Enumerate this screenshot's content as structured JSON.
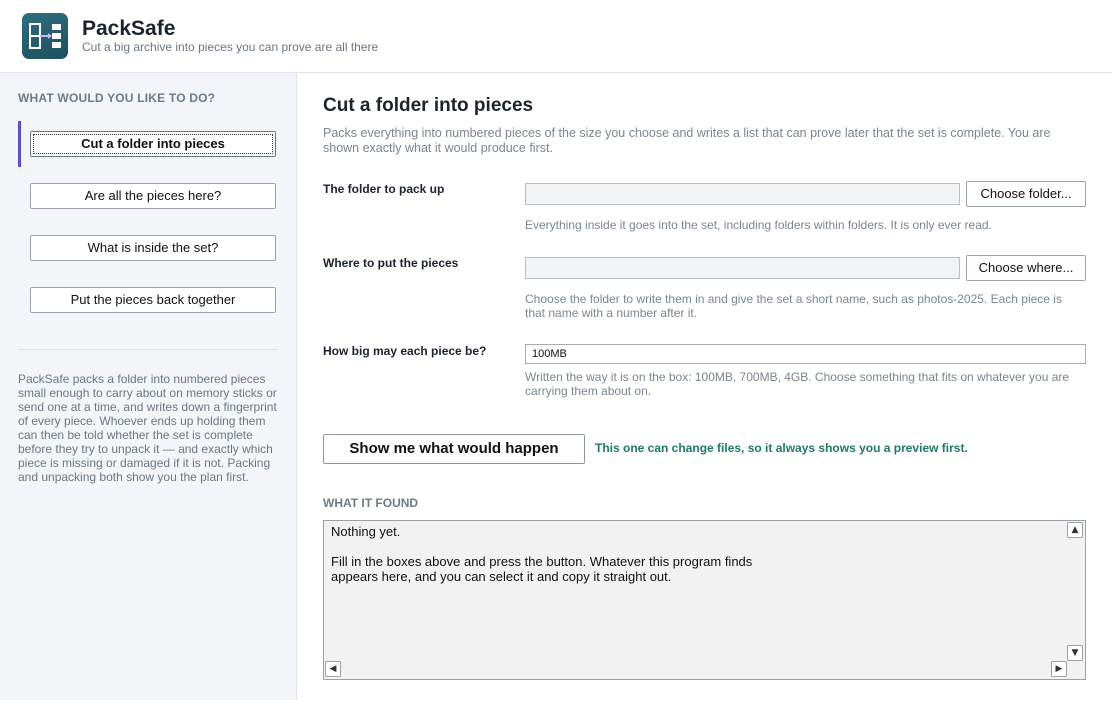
{
  "app": {
    "title": "PackSafe",
    "tagline": "Cut a big archive into pieces you can prove are all there"
  },
  "sidebar": {
    "heading": "WHAT WOULD YOU LIKE TO DO?",
    "items": [
      {
        "label": "Cut a folder into pieces",
        "active": true
      },
      {
        "label": "Are all the pieces here?"
      },
      {
        "label": "What is inside the set?"
      },
      {
        "label": "Put the pieces back together"
      }
    ],
    "about": "PackSafe packs a folder into numbered pieces small enough to carry about on memory sticks or send one at a time, and writes down a fingerprint of every piece. Whoever ends up holding them can then be told whether the set is complete before they try to unpack it — and exactly which piece is missing or damaged if it is not. Packing and unpacking both show you the plan first."
  },
  "main": {
    "title": "Cut a folder into pieces",
    "description": "Packs everything into numbered pieces of the size you choose and writes a list that can prove later that the set is complete. You are shown exactly what it would produce first.",
    "fields": {
      "source": {
        "label": "The folder to pack up",
        "value": "",
        "button": "Choose folder...",
        "hint": "Everything inside it goes into the set, including folders within folders. It is only ever read."
      },
      "destination": {
        "label": "Where to put the pieces",
        "value": "",
        "button": "Choose where...",
        "hint": "Choose the folder to write them in and give the set a short name, such as photos-2025. Each piece is that name with a number after it."
      },
      "size": {
        "label": "How big may each piece be?",
        "value": "100MB",
        "hint": "Written the way it is on the box: 100MB, 700MB, 4GB. Choose something that fits on whatever you are carrying them about on."
      }
    },
    "action_button": "Show me what would happen",
    "action_note": "This one can change files, so it always shows you a preview first.",
    "output": {
      "heading": "WHAT IT FOUND",
      "text": "Nothing yet.\n\nFill in the boxes above and press the button. Whatever this program finds\nappears here, and you can select it and copy it straight out."
    }
  },
  "colors": {
    "accent": "#5b4fd6",
    "logo": "#1d4f5c",
    "note": "#1e7a66"
  },
  "icons": {
    "logo": "packsafe-logo-icon",
    "scroll_up": "scroll-up-arrow-icon",
    "scroll_down": "scroll-down-arrow-icon",
    "scroll_left": "scroll-left-arrow-icon",
    "scroll_right": "scroll-right-arrow-icon"
  }
}
